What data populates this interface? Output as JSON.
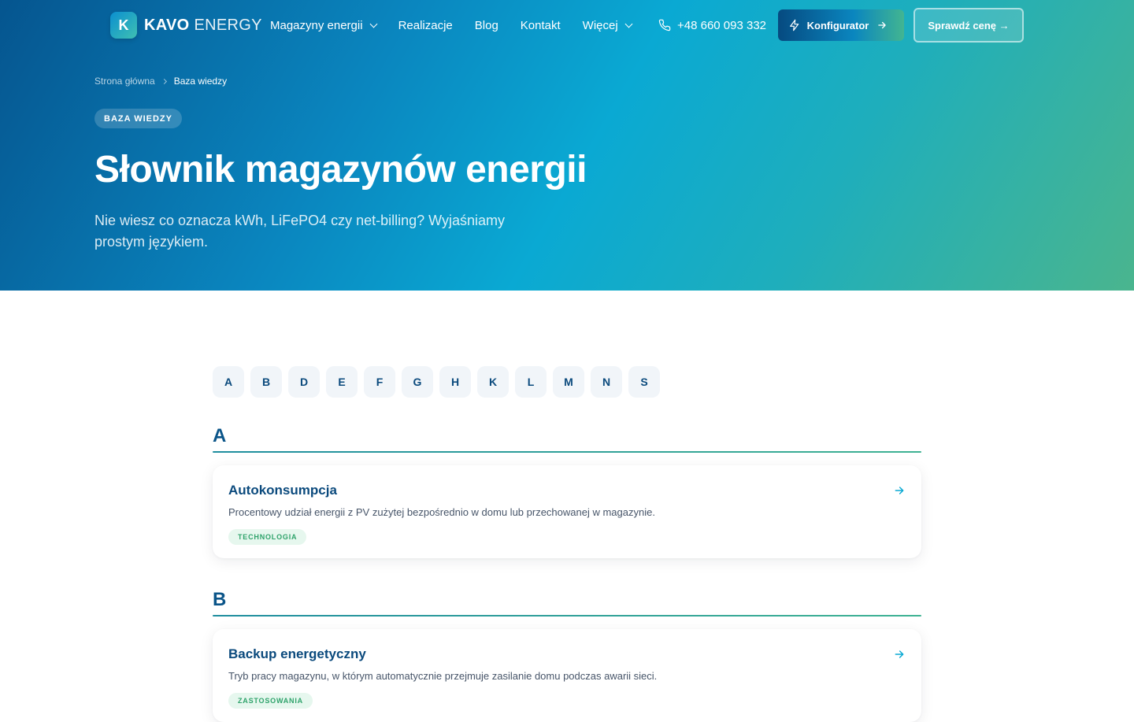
{
  "nav": {
    "logo_mark": "K",
    "logo_bold": "KAVO",
    "logo_light": "ENERGY",
    "links": [
      "Magazyny energii",
      "Realizacje",
      "Blog",
      "Kontakt",
      "Więcej"
    ],
    "phone": "+48 660 093 332",
    "config_label": "Konfigurator",
    "price_label": "Sprawdź cenę →"
  },
  "breadcrumb": {
    "home": "Strona główna",
    "current": "Baza wiedzy"
  },
  "hero": {
    "badge": "BAZA WIEDZY",
    "title": "Słownik magazynów energii",
    "subtitle": "Nie wiesz co oznacza kWh, LiFePO4 czy net-billing? Wyjaśniamy prostym językiem."
  },
  "alphabet": [
    "A",
    "B",
    "D",
    "E",
    "F",
    "G",
    "H",
    "K",
    "L",
    "M",
    "N",
    "S"
  ],
  "sections": [
    {
      "letter": "A",
      "entry": {
        "title": "Autokonsumpcja",
        "description": "Procentowy udział energii z PV zużytej bezpośrednio w domu lub przechowanej w magazynie.",
        "tag": "TECHNOLOGIA"
      }
    },
    {
      "letter": "B",
      "entry": {
        "title": "Backup energetyczny",
        "description": "Tryb pracy magazynu, w którym automatycznie przejmuje zasilanie domu podczas awarii sieci.",
        "tag": "ZASTOSOWANIA"
      }
    }
  ],
  "colors": {
    "brand_dark": "#0b4a7d",
    "accent_cyan": "#0aa9d3",
    "accent_green": "#3fb293",
    "tag_bg": "#e6f7ee",
    "tag_text": "#2fa36b"
  }
}
